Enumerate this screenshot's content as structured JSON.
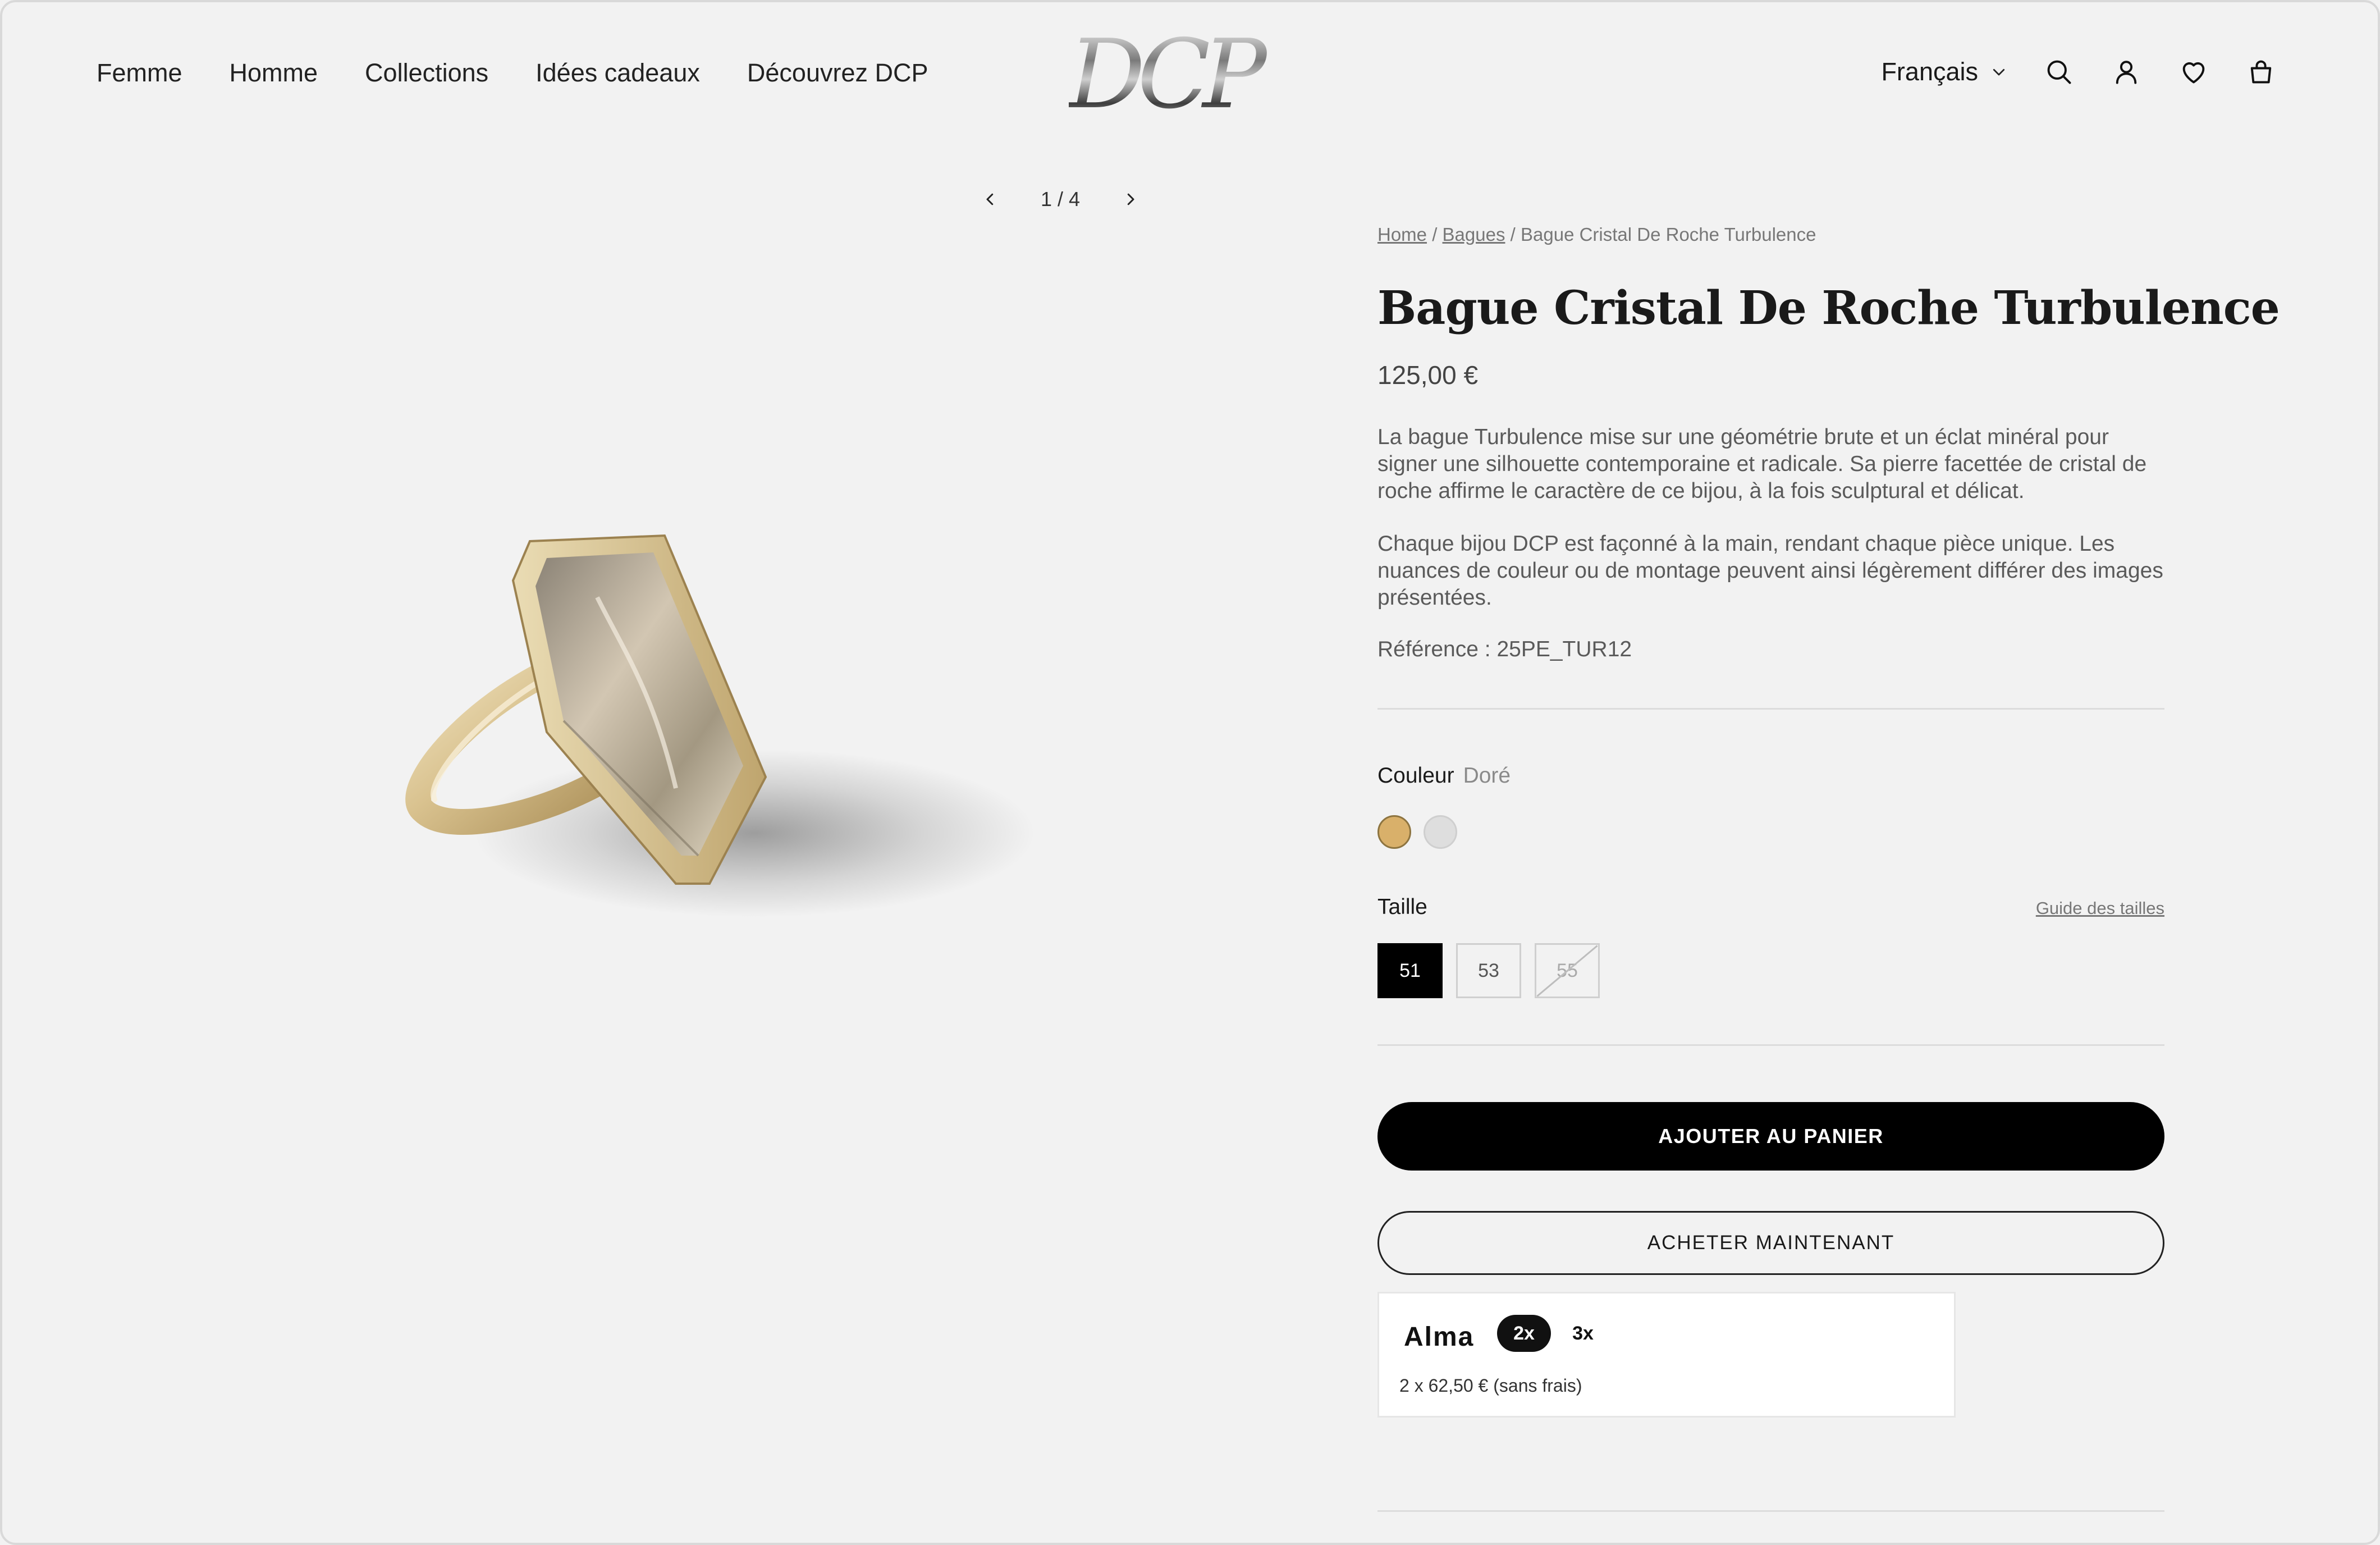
{
  "header": {
    "nav": [
      "Femme",
      "Homme",
      "Collections",
      "Idées cadeaux",
      "Découvrez DCP"
    ],
    "logo": "DCP",
    "language": "Français",
    "icons": [
      "search-icon",
      "account-icon",
      "heart-icon",
      "bag-icon"
    ]
  },
  "gallery": {
    "counter": "1 / 4"
  },
  "breadcrumb": {
    "home": "Home",
    "sep1": "/",
    "category": "Bagues",
    "sep2": "/",
    "current": "Bague Cristal De Roche Turbulence"
  },
  "product": {
    "title": "Bague Cristal De Roche Turbulence",
    "price": "125,00 €",
    "description_1": "La bague Turbulence mise sur une géométrie brute et un éclat minéral pour signer une silhouette contemporaine et radicale. Sa pierre facettée de cristal de roche affirme le caractère de ce bijou, à la fois sculptural et délicat.",
    "description_2": "Chaque bijou DCP est façonné à la main, rendant chaque pièce unique. Les nuances de couleur ou de montage peuvent ainsi légèrement différer des images présentées.",
    "reference": "Référence : 25PE_TUR12"
  },
  "color": {
    "label": "Couleur",
    "selected": "Doré",
    "swatches": [
      "#d9b06a",
      "#dedede"
    ]
  },
  "size": {
    "label": "Taille",
    "guide": "Guide des tailles",
    "options": [
      "51",
      "53",
      "55"
    ],
    "selected": "51",
    "unavailable": [
      "55"
    ]
  },
  "actions": {
    "add_to_cart": "AJOUTER AU PANIER",
    "buy_now": "ACHETER MAINTENANT"
  },
  "alma": {
    "logo": "Alma",
    "option_2x": "2x",
    "option_3x": "3x",
    "detail": "2 x 62,50 € (sans frais)"
  }
}
